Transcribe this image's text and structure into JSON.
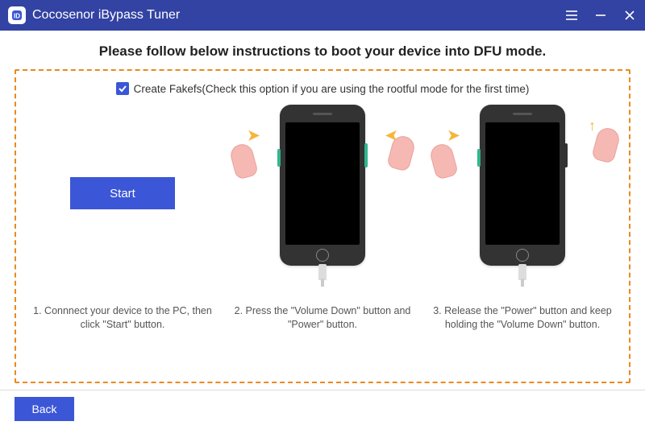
{
  "app": {
    "title": "Cocosenor iBypass Tuner"
  },
  "headline": "Please follow below instructions to boot your device into DFU mode.",
  "checkbox": {
    "label": "Create Fakefs(Check this option if you are using the rootful mode for the first time)",
    "checked": true
  },
  "buttons": {
    "start": "Start",
    "back": "Back"
  },
  "steps": [
    {
      "caption": "1. Connnect your device to the PC, then click \"Start\" button."
    },
    {
      "caption": "2. Press the \"Volume Down\" button and \"Power\" button."
    },
    {
      "caption": "3. Release the \"Power\" button and keep holding the \"Volume Down\" button."
    }
  ],
  "colors": {
    "brand": "#3243a3",
    "primary_button": "#3b56d6",
    "dashed_border": "#e88a1f",
    "highlight_button": "#2fb68e",
    "arrow": "#f4b73a"
  }
}
